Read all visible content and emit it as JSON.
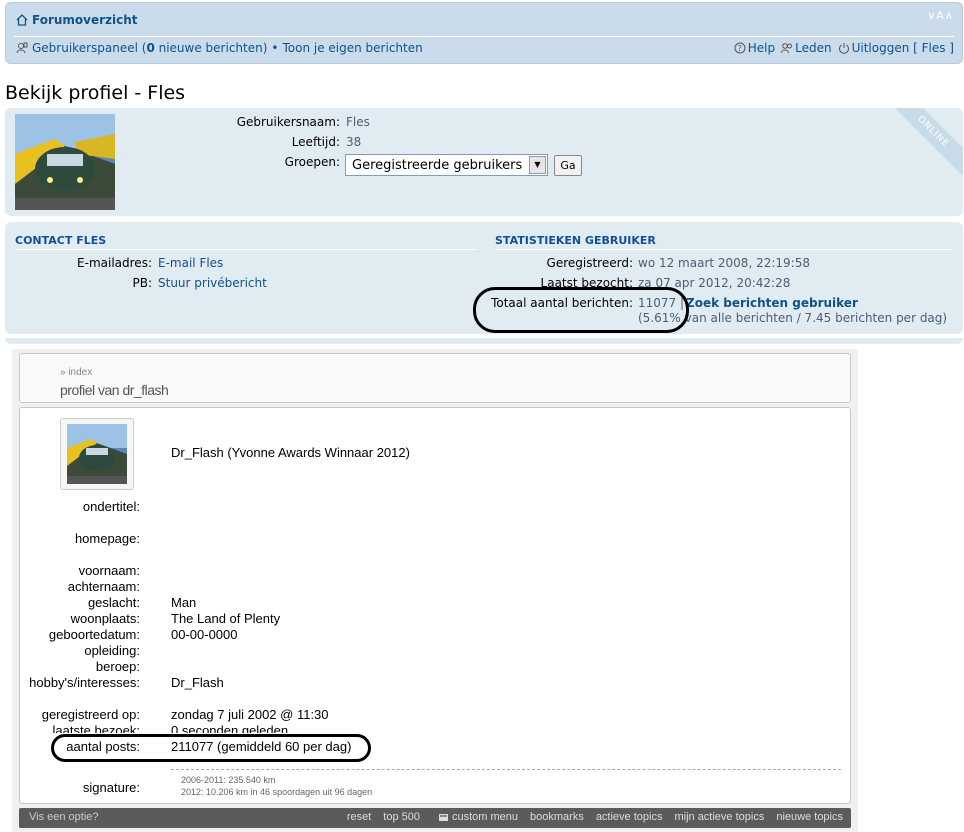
{
  "navbar": {
    "forum_index": "Forumoverzicht",
    "font_controls": "∨A∧",
    "user_panel": "Gebruikerspaneel (",
    "new_count": "0",
    "new_messages": " nieuwe berichten)",
    "bullet": "•",
    "own_posts": "Toon je eigen berichten",
    "help": "Help",
    "members": "Leden",
    "logout": "Uitloggen [ Fles ]"
  },
  "profile": {
    "title": "Bekijk profiel - Fles",
    "username_label": "Gebruikersnaam:",
    "username": "Fles",
    "age_label": "Leeftijd:",
    "age": "38",
    "groups_label": "Groepen:",
    "group_selected": "Geregistreerde gebruikers",
    "go_button": "Ga",
    "online": "ONLINE"
  },
  "contact": {
    "heading": "CONTACT FLES",
    "email_label": "E-mailadres:",
    "email_value": "E-mail Fles",
    "pm_label": "PB:",
    "pm_value": "Stuur privébericht"
  },
  "stats": {
    "heading": "STATISTIEKEN GEBRUIKER",
    "registered_label": "Geregistreerd:",
    "registered_value": "wo 12 maart 2008, 22:19:58",
    "last_visit_label": "Laatst bezocht:",
    "last_visit_value": "za 07 apr 2012, 20:42:28",
    "posts_label": "Totaal aantal berichten:",
    "posts_value": "11077 |",
    "search_link": "Zoek berichten gebruiker",
    "posts_pct": "(5.61%",
    "posts_detail": " van alle berichten / 7.45 berichten per dag)"
  },
  "old_profile": {
    "crumb_small": "» index",
    "crumb_title": "profiel van dr_flash",
    "name": "Dr_Flash (Yvonne Awards Winnaar 2012)",
    "subtitle_label": "ondertitel:",
    "homepage_label": "homepage:",
    "firstname_label": "voornaam:",
    "lastname_label": "achternaam:",
    "gender_label": "geslacht:",
    "gender": "Man",
    "residence_label": "woonplaats:",
    "residence": "The Land of Plenty",
    "birthdate_label": "geboortedatum:",
    "birthdate": "00-00-0000",
    "education_label": "opleiding:",
    "profession_label": "beroep:",
    "hobbies_label": "hobby's/interesses:",
    "hobbies": "Dr_Flash",
    "registered_label": "geregistreerd op:",
    "registered": "zondag 7 juli 2002 @ 11:30",
    "last_visit_label": "laatste bezoek:",
    "last_visit": "0 seconden geleden",
    "posts_label": "aantal posts:",
    "posts": "211077 (gemiddeld 60 per dag)",
    "signature_label": "signature:",
    "sig_line1": "2006-2011: 235.540 km",
    "sig_line2": "2012: 10.206 km in 46 spoordagen uit 96 dagen"
  },
  "old_footer": {
    "left": "Vis een optie?",
    "reset": "reset",
    "top500": "top 500",
    "custom_menu": "custom menu",
    "bookmarks": "bookmarks",
    "active_topics": "actieve topics",
    "my_active_topics": "mijn actieve topics",
    "new_topics": "nieuwe topics"
  }
}
